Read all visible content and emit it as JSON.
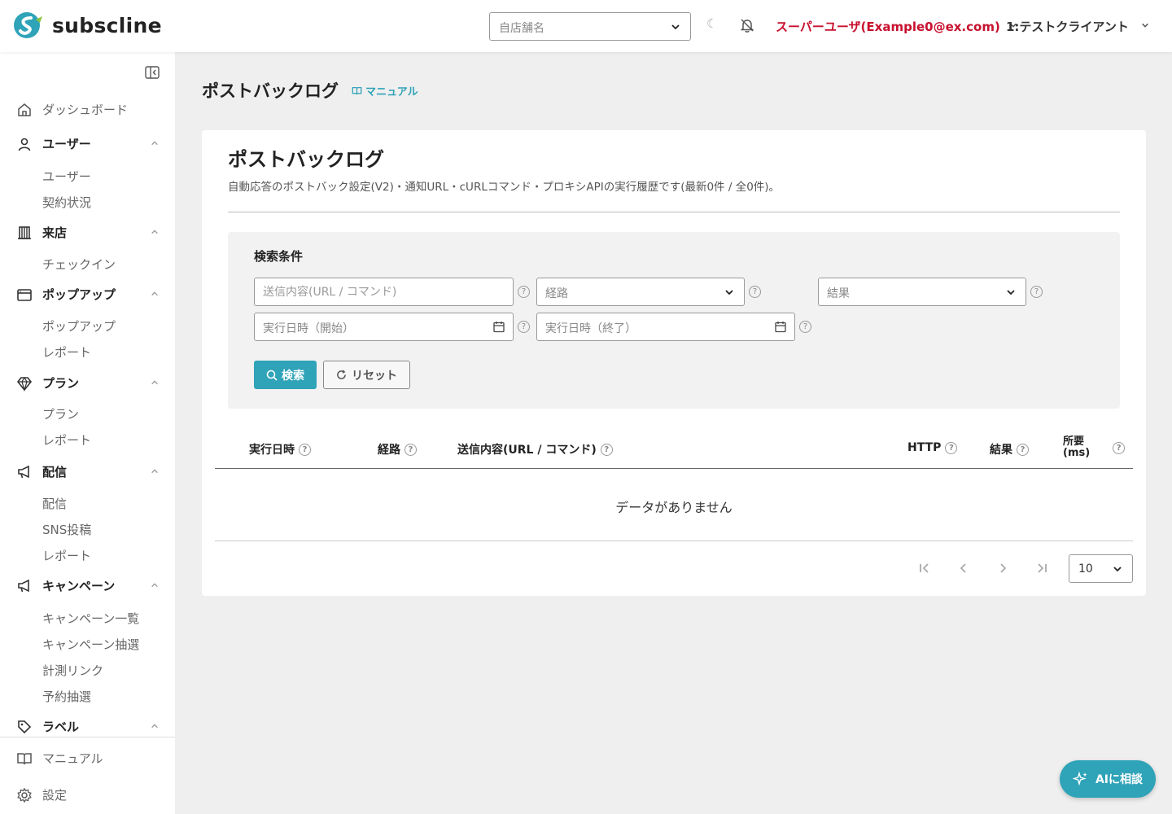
{
  "app": {
    "brand": "subscline"
  },
  "header": {
    "store_placeholder": "自店舗名",
    "user_label": "スーパーユーザ(Example0@ex.com)",
    "client_label": "1:テストクライアント"
  },
  "sidebar": {
    "dashboard": "ダッシュボード",
    "users": {
      "label": "ユーザー",
      "items": [
        "ユーザー",
        "契約状況"
      ]
    },
    "visits": {
      "label": "来店",
      "items": [
        "チェックイン"
      ]
    },
    "popup": {
      "label": "ポップアップ",
      "items": [
        "ポップアップ",
        "レポート"
      ]
    },
    "plan": {
      "label": "プラン",
      "items": [
        "プラン",
        "レポート"
      ]
    },
    "delivery": {
      "label": "配信",
      "items": [
        "配信",
        "SNS投稿",
        "レポート"
      ]
    },
    "campaign": {
      "label": "キャンペーン",
      "items": [
        "キャンペーン一覧",
        "キャンペーン抽選",
        "計測リンク",
        "予約抽選"
      ]
    },
    "label": {
      "label": "ラベル"
    },
    "manual": "マニュアル",
    "settings": "設定"
  },
  "page": {
    "title": "ポストバックログ",
    "manual_link": "マニュアル",
    "card_title": "ポストバックログ",
    "description": "自動応答のポストバック設定(V2)・通知URL・cURLコマンド・プロキシAPIの実行履歴です(最新0件 / 全0件)。"
  },
  "search": {
    "title": "検索条件",
    "content_placeholder": "送信内容(URL / コマンド)",
    "route_placeholder": "経路",
    "result_placeholder": "結果",
    "start_placeholder": "実行日時（開始）",
    "end_placeholder": "実行日時（終了）",
    "search_button": "検索",
    "reset_button": "リセット",
    "help": "?"
  },
  "table": {
    "columns": [
      "実行日時",
      "経路",
      "送信内容(URL / コマンド)",
      "HTTP",
      "結果"
    ],
    "duration_line1": "所要",
    "duration_line2": "(ms)",
    "empty_message": "データがありません"
  },
  "pagination": {
    "per_page": "10"
  },
  "ai_button": "AIに相談",
  "colors": {
    "accent": "#2fa3b8",
    "user": "#c8102e"
  }
}
